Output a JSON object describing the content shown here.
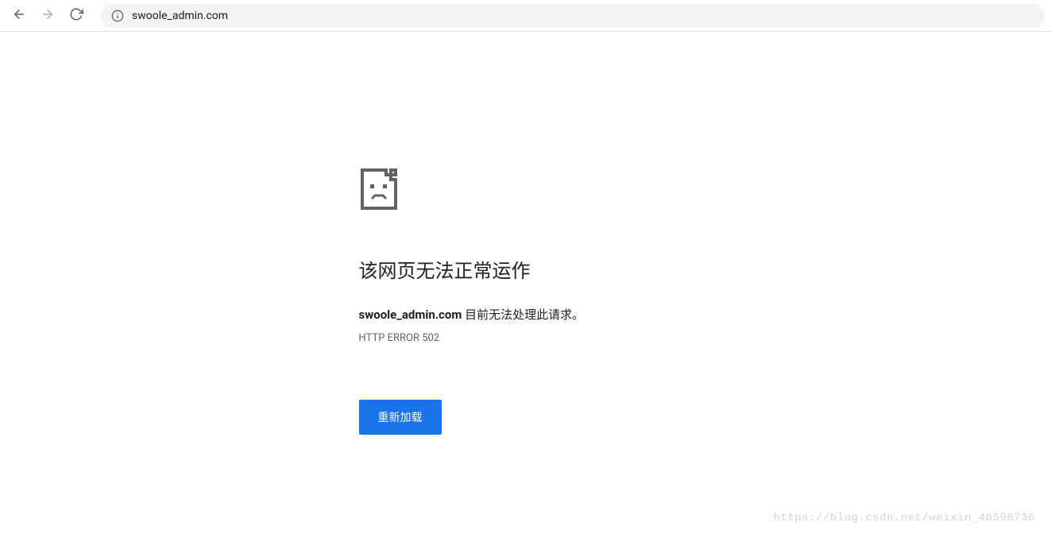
{
  "toolbar": {
    "url": "swoole_admin.com"
  },
  "error": {
    "title": "该网页无法正常运作",
    "domain": "swoole_admin.com",
    "message_suffix": " 目前无法处理此请求。",
    "code": "HTTP ERROR 502",
    "reload_label": "重新加载"
  },
  "watermark": "https://blog.csdn.net/weixin_40596736"
}
